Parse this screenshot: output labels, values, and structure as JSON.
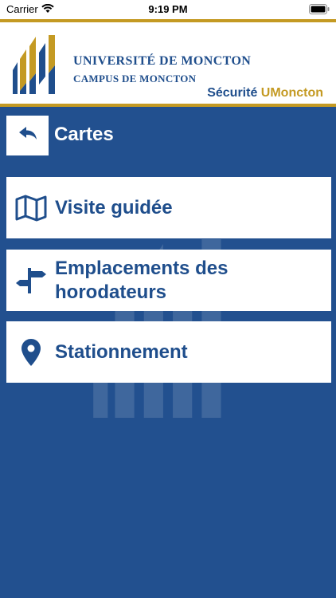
{
  "status_bar": {
    "carrier": "Carrier",
    "time": "9:19 PM"
  },
  "header": {
    "university": "UNIVERSITÉ DE MONCTON",
    "campus": "CAMPUS DE MONCTON",
    "brand_part1": "Sécurité ",
    "brand_part2": "UMoncton"
  },
  "page": {
    "title": "Cartes"
  },
  "menu": {
    "items": [
      {
        "label": "Visite guidée",
        "icon": "map-icon"
      },
      {
        "label": "Emplacements des horodateurs",
        "icon": "signpost-icon"
      },
      {
        "label": "Stationnement",
        "icon": "location-pin-icon"
      }
    ]
  },
  "colors": {
    "primary": "#22508f",
    "text_blue": "#1f4e8c",
    "gold": "#c49a23"
  }
}
